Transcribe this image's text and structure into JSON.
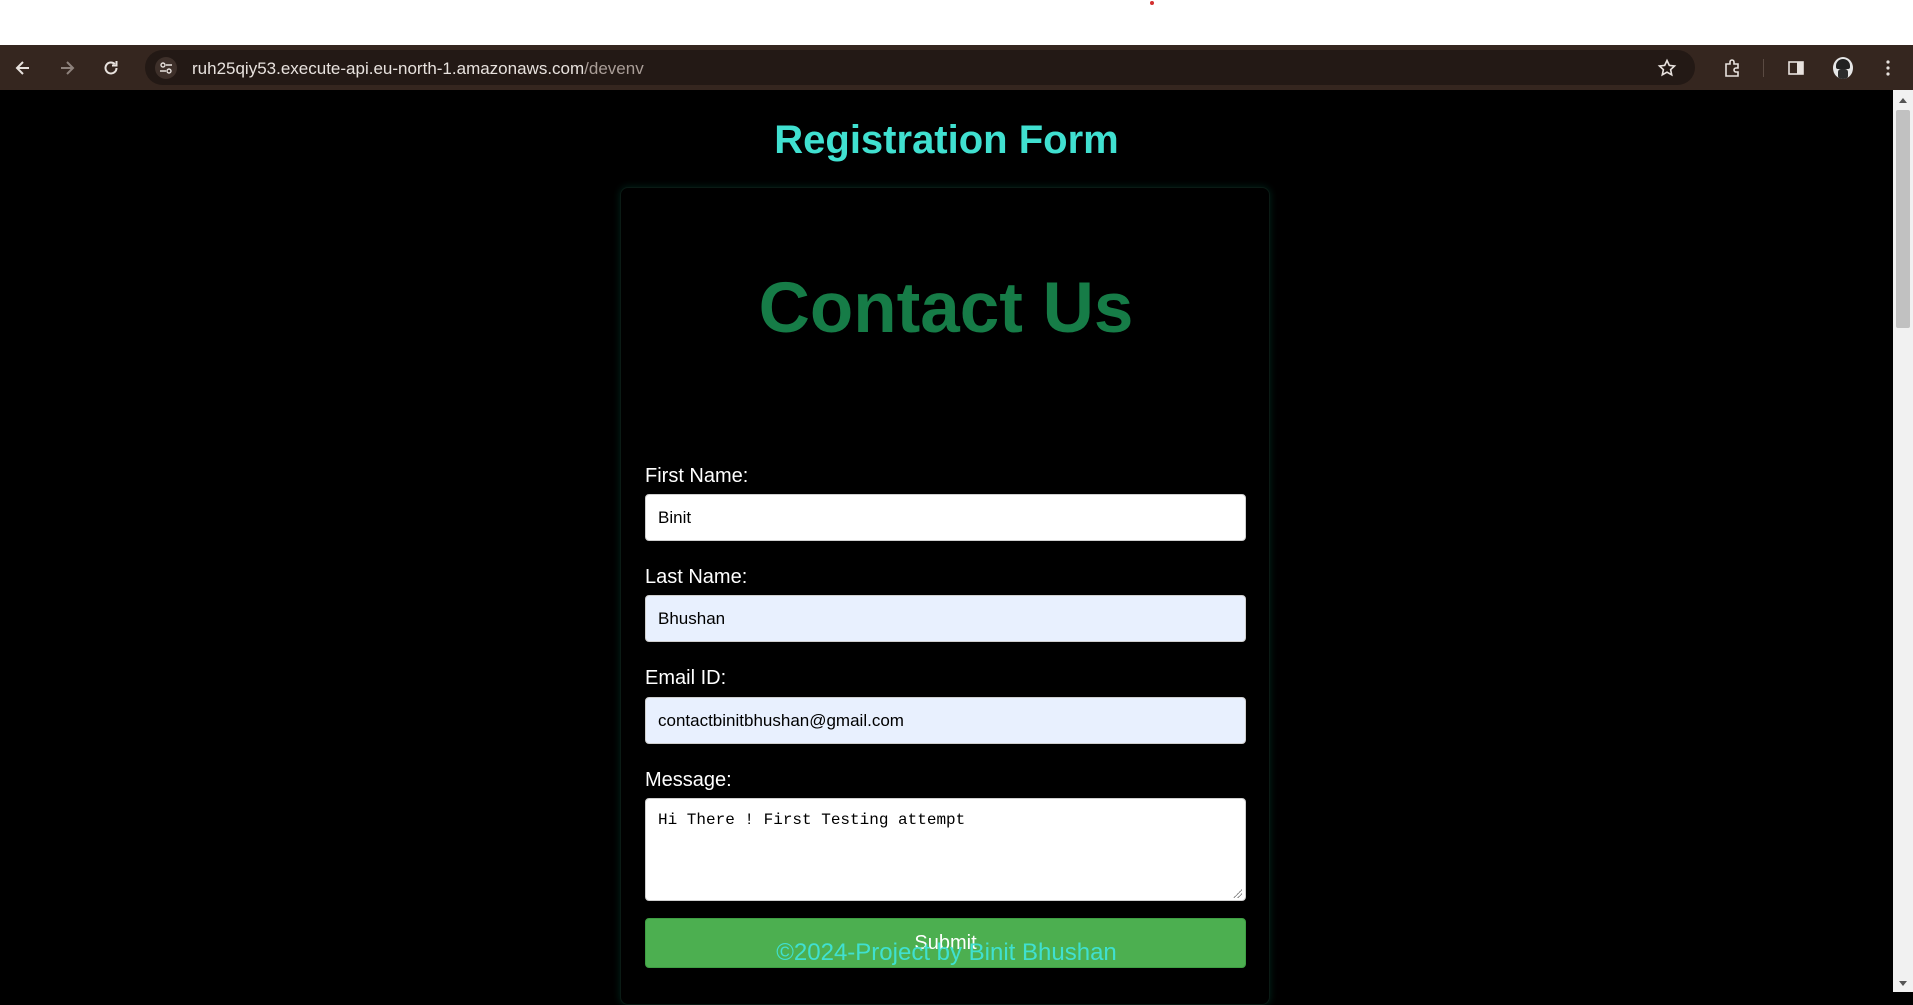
{
  "browser": {
    "url_host": "ruh25qiy53.execute-api.eu-north-1.amazonaws.com",
    "url_path": "/devenv",
    "icons": [
      "back-arrow-icon",
      "forward-arrow-icon",
      "reload-icon",
      "site-settings-icon",
      "star-icon",
      "extensions-icon",
      "side-panel-icon",
      "profile-avatar",
      "menu-kebab-icon"
    ]
  },
  "page": {
    "heading": "Registration Form",
    "form": {
      "title": "Contact Us",
      "first_name": {
        "label": "First Name:",
        "value": "Binit"
      },
      "last_name": {
        "label": "Last Name:",
        "value": "Bhushan"
      },
      "email": {
        "label": "Email ID:",
        "value": "contactbinitbhushan@gmail.com"
      },
      "message": {
        "label": "Message:",
        "value": "Hi There ! First Testing attempt"
      },
      "submit_label": "Submit"
    },
    "footer": "©2024-Project by Binit Bhushan"
  },
  "colors": {
    "heading": "#40e0d0",
    "form_title": "#167c47",
    "submit": "#4caf50",
    "autofill_bg": "#e8f0fe",
    "toolbar": "#35261f"
  }
}
